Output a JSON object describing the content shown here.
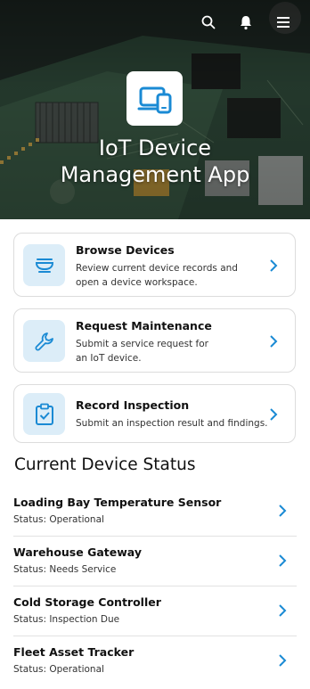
{
  "header": {
    "app_title_line1": "IoT Device",
    "app_title_line2": "Management App",
    "icons": [
      "search-icon",
      "bell-icon",
      "menu-icon",
      "devices-icon"
    ]
  },
  "actions": [
    {
      "title": "Browse Devices",
      "description": "Review current device records and open a device workspace.",
      "icon": "bowl-device-icon"
    },
    {
      "title": "Request Maintenance",
      "description": "Submit a service request for an IoT device.",
      "icon": "wrench-icon"
    },
    {
      "title": "Record Inspection",
      "description": "Submit an inspection result and findings.",
      "icon": "clipboard-check-icon"
    }
  ],
  "status_section": {
    "title": "Current Device Status",
    "devices": [
      {
        "name": "Loading Bay Temperature Sensor",
        "status": "Status: Operational"
      },
      {
        "name": "Warehouse Gateway",
        "status": "Status: Needs Service"
      },
      {
        "name": "Cold Storage Controller",
        "status": "Status: Inspection Due"
      },
      {
        "name": "Fleet Asset Tracker",
        "status": "Status: Operational"
      }
    ]
  },
  "colors": {
    "accent": "#1a8ad4",
    "icon_bg": "#dcedf8",
    "hero_dark": "#1c2823"
  }
}
